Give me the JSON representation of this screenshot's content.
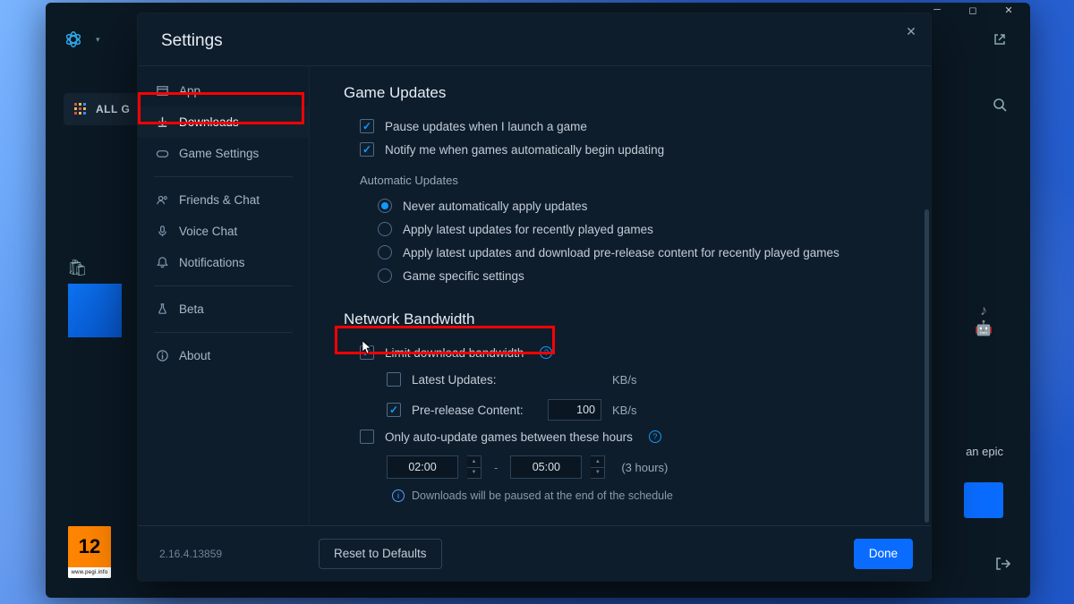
{
  "app": {
    "nav_all_games": "ALL G",
    "promo_text": "an epic",
    "pegi_rating": "12",
    "pegi_footer": "www.pegi.info"
  },
  "settings": {
    "title": "Settings",
    "version": "2.16.4.13859",
    "footer": {
      "reset": "Reset to Defaults",
      "done": "Done"
    },
    "nav": {
      "app": "App",
      "downloads": "Downloads",
      "game_settings": "Game Settings",
      "friends": "Friends & Chat",
      "voice": "Voice Chat",
      "notifications": "Notifications",
      "beta": "Beta",
      "about": "About"
    },
    "section_updates": {
      "title": "Game Updates",
      "pause_on_launch": "Pause updates when I launch a game",
      "notify_auto": "Notify me when games automatically begin updating",
      "auto_heading": "Automatic Updates",
      "opts": {
        "never": "Never automatically apply updates",
        "recent": "Apply latest updates for recently played games",
        "prerelease": "Apply latest updates and download pre-release content for recently played games",
        "specific": "Game specific settings"
      }
    },
    "section_bw": {
      "title": "Network Bandwidth",
      "limit": "Limit download bandwidth",
      "latest": "Latest Updates:",
      "prerelease": "Pre-release Content:",
      "value_prerelease": "100",
      "unit": "KB/s",
      "only_hours": "Only auto-update games between these hours",
      "time_from": "02:00",
      "time_to": "05:00",
      "duration": "(3 hours)",
      "schedule_note": "Downloads will be paused at the end of the schedule"
    }
  }
}
